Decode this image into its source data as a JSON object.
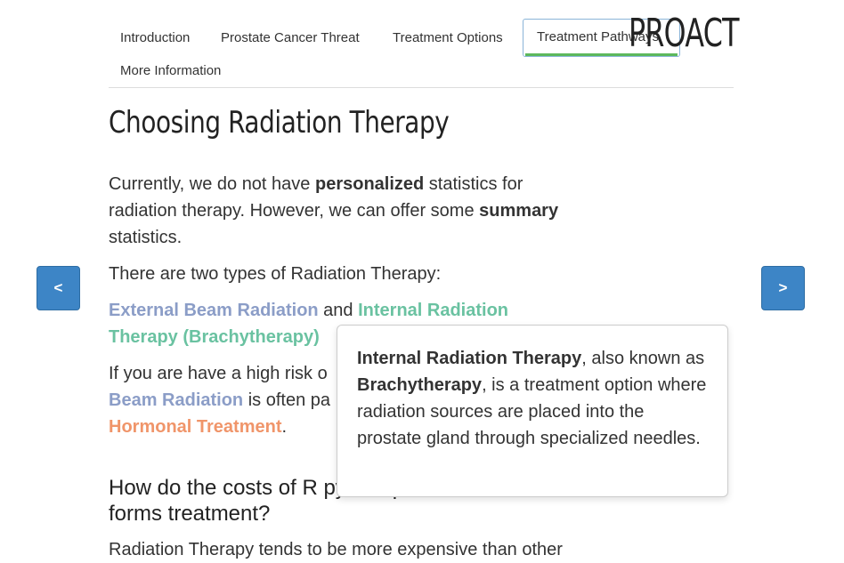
{
  "nav": {
    "items": [
      "Introduction",
      "Prostate Cancer Threat",
      "Treatment Options",
      "Treatment Pathways",
      "More Information"
    ],
    "active": "Treatment Pathways"
  },
  "brand": "PROACT",
  "page_title": "Choosing Radiation Therapy",
  "intro": {
    "t1": "Currently, we do not have ",
    "b1": "personalized",
    "t2": " statistics for radiation therapy. However, we can offer some ",
    "b2": "summary",
    "t3": " statistics."
  },
  "types_intro": "There are two types of Radiation Therapy:",
  "types": {
    "external": "External Beam Radiation",
    "and": " and ",
    "internal": "Internal Radiation Therapy (Brachytherapy)"
  },
  "risk": {
    "t1": "If you are have a high risk o",
    "blue": "Beam Radiation",
    "t2": " is often pa",
    "orange": "Hormonal Treatment",
    "t3": "."
  },
  "costs_heading": "How do the costs of R                       py compare with other forms treatment?",
  "costs_text": "Radiation Therapy tends to be more expensive than other",
  "prev_button": "<",
  "next_button": ">",
  "popover": {
    "b1": "Internal Radiation Therapy",
    "t1": ", also known as ",
    "b2": "Brachytherapy",
    "t2": ", is a treatment option where radiation sources are placed into the prostate gland through specialized needles."
  },
  "colors": {
    "external_beam": "#8b9dc7",
    "internal": "#6ac2a1",
    "hormonal": "#f0956a",
    "button": "#3d85c6",
    "active_underline": "#5cb85c"
  }
}
